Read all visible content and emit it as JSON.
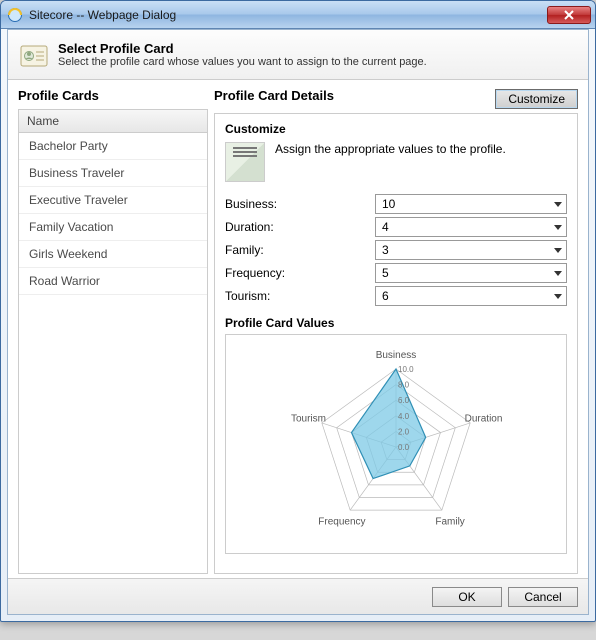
{
  "window": {
    "title": "Sitecore -- Webpage Dialog"
  },
  "header": {
    "title": "Select Profile Card",
    "subtitle": "Select the profile card whose values you want to assign to the current page."
  },
  "left": {
    "title": "Profile Cards",
    "column_header": "Name",
    "items": [
      {
        "label": "Bachelor Party"
      },
      {
        "label": "Business Traveler"
      },
      {
        "label": "Executive Traveler"
      },
      {
        "label": "Family Vacation"
      },
      {
        "label": "Girls Weekend"
      },
      {
        "label": "Road Warrior"
      }
    ]
  },
  "right": {
    "title": "Profile Card Details",
    "customize_btn": "Customize",
    "customize_heading": "Customize",
    "customize_desc": "Assign the appropriate values to the profile.",
    "fields": [
      {
        "label": "Business:",
        "value": "10"
      },
      {
        "label": "Duration:",
        "value": "4"
      },
      {
        "label": "Family:",
        "value": "3"
      },
      {
        "label": "Frequency:",
        "value": "5"
      },
      {
        "label": "Tourism:",
        "value": "6"
      }
    ],
    "values_heading": "Profile Card Values"
  },
  "footer": {
    "ok": "OK",
    "cancel": "Cancel"
  },
  "chart_data": {
    "type": "radar",
    "categories": [
      "Business",
      "Duration",
      "Family",
      "Frequency",
      "Tourism"
    ],
    "values": [
      10,
      4,
      3,
      5,
      6
    ],
    "max": 10,
    "rings": [
      0,
      2,
      4,
      6,
      8,
      10
    ],
    "tick_labels": [
      "0.0",
      "2.0",
      "4.0",
      "6.0",
      "8.0",
      "10.0"
    ],
    "fill": "#7ec9e6",
    "stroke": "#2f8fb5"
  }
}
